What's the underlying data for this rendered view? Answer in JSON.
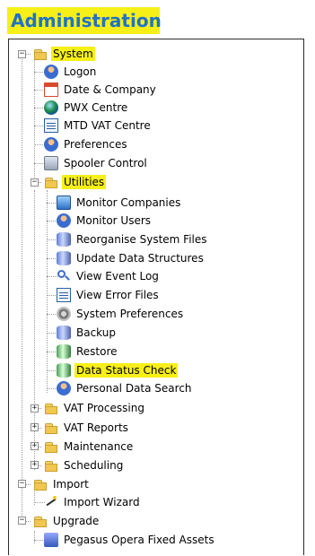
{
  "header": {
    "title": "Administration"
  },
  "tree": {
    "nodes": [
      {
        "label": "System",
        "highlight": true
      },
      {
        "label": "Logon"
      },
      {
        "label": "Date & Company"
      },
      {
        "label": "PWX Centre"
      },
      {
        "label": "MTD VAT Centre"
      },
      {
        "label": "Preferences"
      },
      {
        "label": "Spooler Control"
      },
      {
        "label": "Utilities",
        "highlight": true
      },
      {
        "label": "Monitor Companies"
      },
      {
        "label": "Monitor Users"
      },
      {
        "label": "Reorganise System Files"
      },
      {
        "label": "Update Data Structures"
      },
      {
        "label": "View Event Log"
      },
      {
        "label": "View Error Files"
      },
      {
        "label": "System Preferences"
      },
      {
        "label": "Backup"
      },
      {
        "label": "Restore"
      },
      {
        "label": "Data Status Check",
        "highlight": true
      },
      {
        "label": "Personal Data Search"
      },
      {
        "label": "VAT Processing"
      },
      {
        "label": "VAT Reports"
      },
      {
        "label": "Maintenance"
      },
      {
        "label": "Scheduling"
      },
      {
        "label": "Import"
      },
      {
        "label": "Import Wizard"
      },
      {
        "label": "Upgrade"
      },
      {
        "label": "Pegasus Opera Fixed Assets"
      }
    ]
  },
  "colors": {
    "highlight": "#f7ef18",
    "header_text": "#1f73c6",
    "tree_line": "#9a9a9a"
  }
}
